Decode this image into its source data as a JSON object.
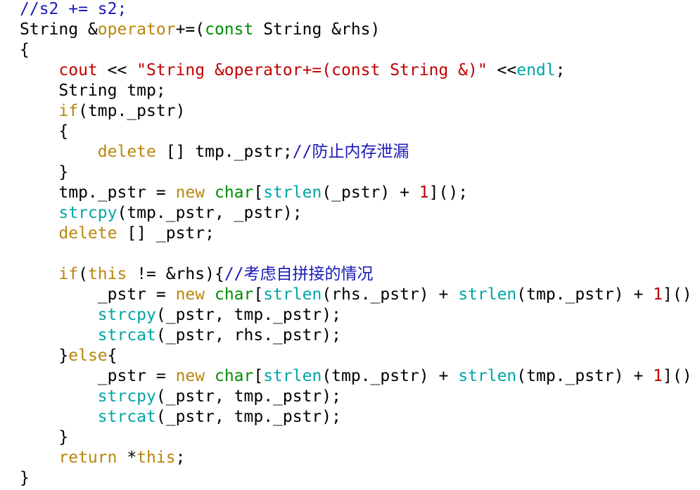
{
  "colors": {
    "background": "#ffffff",
    "plain": "#000000",
    "keyword": "#b8860b",
    "type": "#008b00",
    "function": "#00a5a5",
    "string": "#c00000",
    "number": "#c00000",
    "comment": "#1a1ab8"
  },
  "code": {
    "lines": [
      [
        {
          "t": "comment",
          "v": "//s2 += s2;"
        }
      ],
      [
        {
          "t": "plain",
          "v": "String &"
        },
        {
          "t": "keyword",
          "v": "operator"
        },
        {
          "t": "plain",
          "v": "+=("
        },
        {
          "t": "type",
          "v": "const"
        },
        {
          "t": "plain",
          "v": " String &rhs)"
        }
      ],
      [
        {
          "t": "plain",
          "v": "{"
        }
      ],
      [
        {
          "t": "plain",
          "v": "    "
        },
        {
          "t": "stream",
          "v": "cout"
        },
        {
          "t": "plain",
          "v": " << "
        },
        {
          "t": "string",
          "v": "\"String &operator+=(const String &)\""
        },
        {
          "t": "plain",
          "v": " <<"
        },
        {
          "t": "manip",
          "v": "endl"
        },
        {
          "t": "plain",
          "v": ";"
        }
      ],
      [
        {
          "t": "plain",
          "v": "    String tmp;"
        }
      ],
      [
        {
          "t": "plain",
          "v": "    "
        },
        {
          "t": "keyword",
          "v": "if"
        },
        {
          "t": "plain",
          "v": "(tmp._pstr)"
        }
      ],
      [
        {
          "t": "plain",
          "v": "    {"
        }
      ],
      [
        {
          "t": "plain",
          "v": "        "
        },
        {
          "t": "keyword",
          "v": "delete"
        },
        {
          "t": "plain",
          "v": " [] tmp._pstr;"
        },
        {
          "t": "comment",
          "v": "//防止内存泄漏"
        }
      ],
      [
        {
          "t": "plain",
          "v": "    }"
        }
      ],
      [
        {
          "t": "plain",
          "v": "    tmp._pstr = "
        },
        {
          "t": "keyword",
          "v": "new"
        },
        {
          "t": "plain",
          "v": " "
        },
        {
          "t": "type",
          "v": "char"
        },
        {
          "t": "plain",
          "v": "["
        },
        {
          "t": "func",
          "v": "strlen"
        },
        {
          "t": "plain",
          "v": "(_pstr) + "
        },
        {
          "t": "number",
          "v": "1"
        },
        {
          "t": "plain",
          "v": "]();"
        }
      ],
      [
        {
          "t": "plain",
          "v": "    "
        },
        {
          "t": "func",
          "v": "strcpy"
        },
        {
          "t": "plain",
          "v": "(tmp._pstr, _pstr);"
        }
      ],
      [
        {
          "t": "plain",
          "v": "    "
        },
        {
          "t": "keyword",
          "v": "delete"
        },
        {
          "t": "plain",
          "v": " [] _pstr;"
        }
      ],
      [
        {
          "t": "plain",
          "v": ""
        }
      ],
      [
        {
          "t": "plain",
          "v": "    "
        },
        {
          "t": "keyword",
          "v": "if"
        },
        {
          "t": "plain",
          "v": "("
        },
        {
          "t": "keyword",
          "v": "this"
        },
        {
          "t": "plain",
          "v": " != &rhs){"
        },
        {
          "t": "comment",
          "v": "//考虑自拼接的情况"
        }
      ],
      [
        {
          "t": "plain",
          "v": "        _pstr = "
        },
        {
          "t": "keyword",
          "v": "new"
        },
        {
          "t": "plain",
          "v": " "
        },
        {
          "t": "type",
          "v": "char"
        },
        {
          "t": "plain",
          "v": "["
        },
        {
          "t": "func",
          "v": "strlen"
        },
        {
          "t": "plain",
          "v": "(rhs._pstr) + "
        },
        {
          "t": "func",
          "v": "strlen"
        },
        {
          "t": "plain",
          "v": "(tmp._pstr) + "
        },
        {
          "t": "number",
          "v": "1"
        },
        {
          "t": "plain",
          "v": "]()"
        }
      ],
      [
        {
          "t": "plain",
          "v": "        "
        },
        {
          "t": "func",
          "v": "strcpy"
        },
        {
          "t": "plain",
          "v": "(_pstr, tmp._pstr);"
        }
      ],
      [
        {
          "t": "plain",
          "v": "        "
        },
        {
          "t": "func",
          "v": "strcat"
        },
        {
          "t": "plain",
          "v": "(_pstr, rhs._pstr);"
        }
      ],
      [
        {
          "t": "plain",
          "v": "    }"
        },
        {
          "t": "keyword",
          "v": "else"
        },
        {
          "t": "plain",
          "v": "{"
        }
      ],
      [
        {
          "t": "plain",
          "v": "        _pstr = "
        },
        {
          "t": "keyword",
          "v": "new"
        },
        {
          "t": "plain",
          "v": " "
        },
        {
          "t": "type",
          "v": "char"
        },
        {
          "t": "plain",
          "v": "["
        },
        {
          "t": "func",
          "v": "strlen"
        },
        {
          "t": "plain",
          "v": "(tmp._pstr) + "
        },
        {
          "t": "func",
          "v": "strlen"
        },
        {
          "t": "plain",
          "v": "(tmp._pstr) + "
        },
        {
          "t": "number",
          "v": "1"
        },
        {
          "t": "plain",
          "v": "]()"
        }
      ],
      [
        {
          "t": "plain",
          "v": "        "
        },
        {
          "t": "func",
          "v": "strcpy"
        },
        {
          "t": "plain",
          "v": "(_pstr, tmp._pstr);"
        }
      ],
      [
        {
          "t": "plain",
          "v": "        "
        },
        {
          "t": "func",
          "v": "strcat"
        },
        {
          "t": "plain",
          "v": "(_pstr, tmp._pstr);"
        }
      ],
      [
        {
          "t": "plain",
          "v": "    }"
        }
      ],
      [
        {
          "t": "plain",
          "v": "    "
        },
        {
          "t": "keyword",
          "v": "return"
        },
        {
          "t": "plain",
          "v": " *"
        },
        {
          "t": "keyword",
          "v": "this"
        },
        {
          "t": "plain",
          "v": ";"
        }
      ],
      [
        {
          "t": "plain",
          "v": "}"
        }
      ]
    ]
  }
}
